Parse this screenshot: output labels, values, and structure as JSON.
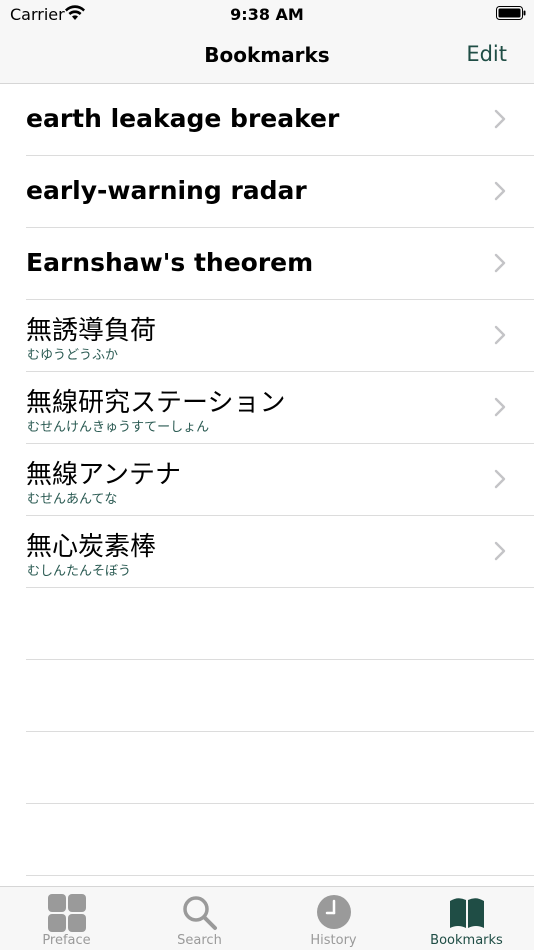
{
  "status": {
    "carrier": "Carrier",
    "time": "9:38 AM"
  },
  "nav": {
    "title": "Bookmarks",
    "edit_label": "Edit"
  },
  "bookmarks": [
    {
      "term": "earth leakage breaker",
      "reading": ""
    },
    {
      "term": "early-warning radar",
      "reading": ""
    },
    {
      "term": "Earnshaw's theorem",
      "reading": ""
    },
    {
      "term": "無誘導負荷",
      "reading": "むゆうどうふか"
    },
    {
      "term": "無線研究ステーション",
      "reading": "むせんけんきゅうすてーしょん"
    },
    {
      "term": "無線アンテナ",
      "reading": "むせんあんてな"
    },
    {
      "term": "無心炭素棒",
      "reading": "むしんたんそぼう"
    }
  ],
  "tabs": [
    {
      "label": "Preface",
      "icon": "preface-grid-icon"
    },
    {
      "label": "Search",
      "icon": "search-icon"
    },
    {
      "label": "History",
      "icon": "clock-icon"
    },
    {
      "label": "Bookmarks",
      "icon": "book-icon"
    }
  ],
  "colors": {
    "accent": "#1f4d45",
    "inactive": "#9a9a9a",
    "reading": "#2a5a52"
  }
}
